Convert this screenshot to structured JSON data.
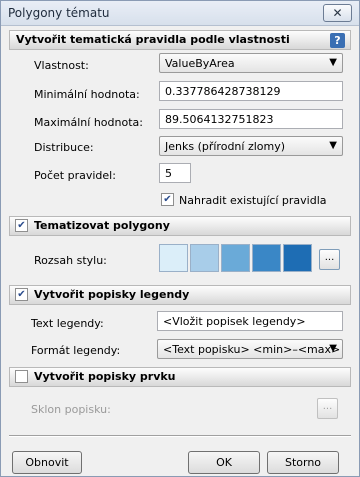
{
  "window": {
    "title": "Polygony tématu",
    "close_glyph": "✕"
  },
  "section_rules": {
    "title": "Vytvořit tematická pravidla podle vlastnosti",
    "help_glyph": "?",
    "property_label": "Vlastnost:",
    "property_value": "ValueByArea",
    "min_label": "Minimální hodnota:",
    "min_value": "0.337786428738129",
    "max_label": "Maximální hodnota:",
    "max_value": "89.5064132751823",
    "distribution_label": "Distribuce:",
    "distribution_value": "Jenks (přírodní zlomy)",
    "rule_count_label": "Počet pravidel:",
    "rule_count_value": "5",
    "replace_label": "Nahradit existující pravidla",
    "replace_checked": true
  },
  "section_polygons": {
    "title": "Tematizovat polygony",
    "checked": true,
    "style_range_label": "Rozsah stylu:",
    "swatches": [
      "#dbeef9",
      "#a8cde9",
      "#6aaad8",
      "#3a87c6",
      "#1e6db4"
    ],
    "browse_glyph": "..."
  },
  "section_legend": {
    "title": "Vytvořit popisky legendy",
    "checked": true,
    "text_label": "Text legendy:",
    "text_value": "<Vložit popisek legendy>",
    "format_label": "Formát legendy:",
    "format_value": "<Text popisku> <min>–<max>"
  },
  "section_feature_labels": {
    "title": "Vytvořit popisky prvku",
    "checked": false,
    "angle_label": "Sklon popisku:",
    "browse_glyph": "..."
  },
  "buttons": {
    "refresh": "Obnovit",
    "ok": "OK",
    "cancel": "Storno"
  },
  "icons": {
    "check_glyph": "✔",
    "dropdown_arrow": "▼"
  }
}
